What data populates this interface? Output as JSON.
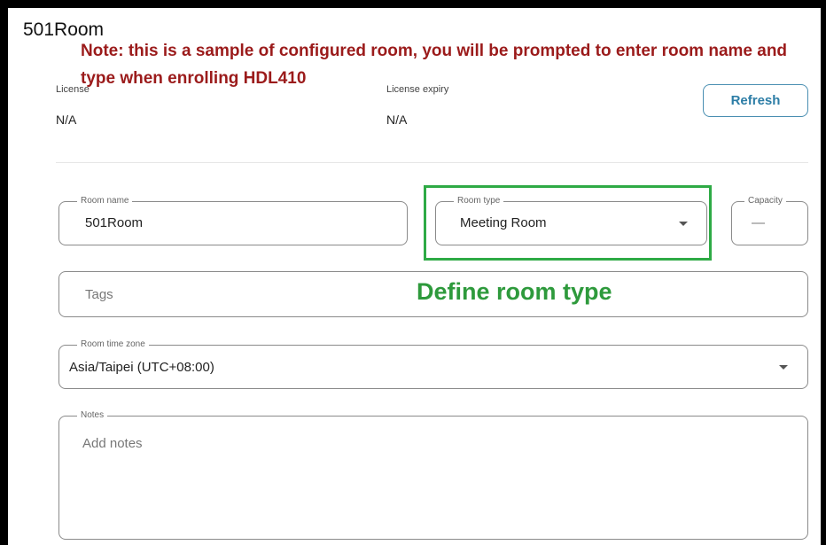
{
  "room_title": "501Room",
  "annotation": {
    "note": "Note: this is a sample of configured room, you will be prompted to enter room name and type when enrolling HDL410",
    "define_room_type": "Define room type"
  },
  "meta": {
    "license_label": "License",
    "license_value": "N/A",
    "license_expiry_label": "License expiry",
    "license_expiry_value": "N/A",
    "refresh_label": "Refresh"
  },
  "form": {
    "room_name_label": "Room name",
    "room_name_value": "501Room",
    "room_type_label": "Room type",
    "room_type_value": "Meeting Room",
    "capacity_label": "Capacity",
    "capacity_value": "—",
    "tags_placeholder": "Tags",
    "time_zone_label": "Room time zone",
    "time_zone_value": "Asia/Taipei (UTC+08:00)",
    "notes_label": "Notes",
    "notes_placeholder": "Add notes"
  },
  "colors": {
    "note_text": "#9b1b1b",
    "highlight": "#2eaa45",
    "refresh_accent": "#2c7da6"
  }
}
